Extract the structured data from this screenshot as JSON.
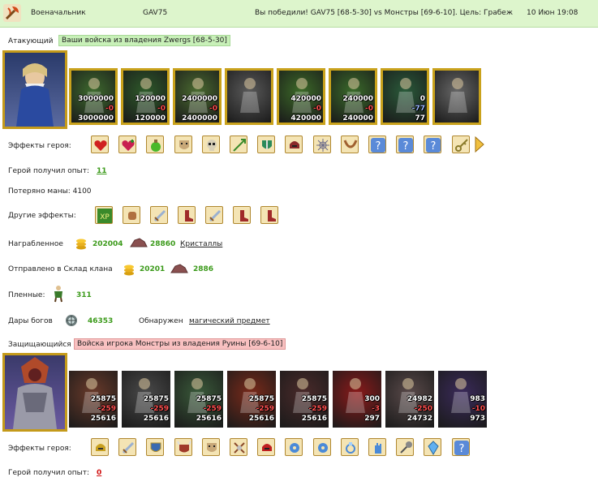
{
  "header": {
    "rank": "Военачальник",
    "player": "GAV75",
    "result": "Вы победили! GAV75 [68-5-30] vs Монстры [69-6-10]. Цель: Грабеж",
    "date": "10 Июн 19:08"
  },
  "attacker": {
    "label": "Атакующий",
    "army": "Ваши войска из владения Zwergs [68-5-30]",
    "units": [
      {
        "name": "unit-1",
        "top": "3000000",
        "mid": "-0",
        "bot": "3000000",
        "color": "#3e6a2e"
      },
      {
        "name": "unit-2",
        "top": "120000",
        "mid": "-0",
        "bot": "120000",
        "color": "#2e5a2a"
      },
      {
        "name": "unit-3",
        "top": "2400000",
        "mid": "-0",
        "bot": "2400000",
        "color": "#4a6a30"
      },
      {
        "name": "unit-4",
        "top": "",
        "mid": "",
        "bot": "",
        "color": "#5a5a5a"
      },
      {
        "name": "unit-5",
        "top": "420000",
        "mid": "-0",
        "bot": "420000",
        "color": "#3c6a28"
      },
      {
        "name": "unit-6",
        "top": "240000",
        "mid": "-0",
        "bot": "240000",
        "color": "#3a6a2a"
      },
      {
        "name": "unit-7",
        "top": "0",
        "mid": "-77",
        "bot": "77",
        "color": "#2a5a3a"
      },
      {
        "name": "unit-8",
        "top": "",
        "mid": "",
        "bot": "",
        "color": "#666"
      }
    ],
    "hero_effects_label": "Эффекты героя:",
    "hero_effects": [
      "heart-icon",
      "heart-plus-icon",
      "potion-icon",
      "mask-icon",
      "skull-mask-icon",
      "arrows-icon",
      "shield-sword-icon",
      "helmet-icon",
      "web-icon",
      "horns-icon",
      "question-icon",
      "question-icon",
      "question-icon",
      "key-icon"
    ],
    "exp_label": "Герой получил опыт:",
    "exp_value": "11",
    "mana_label": "Потеряно маны: 4100",
    "other_label": "Другие эффекты:",
    "other_effects": [
      "xp-icon",
      "fist-icon",
      "sword-icon",
      "boot-icon",
      "sword-icon",
      "boot-icon",
      "boot-icon"
    ],
    "loot_label": "Награбленное",
    "loot_gold": "202004",
    "loot_crystal": "28860",
    "loot_crystal_link": "Кристаллы",
    "clan_label": "Отправлено в Склад клана",
    "clan_gold": "20201",
    "clan_crystal": "2886",
    "prisoners_label": "Пленные:",
    "prisoners_value": "311",
    "gifts_label": "Дары богов",
    "gifts_value": "46353",
    "found_label": "Обнаружен",
    "found_link": "магический предмет"
  },
  "defender": {
    "label": "Защищающийся",
    "army": "Войска игрока Монстры из владения Руины [69-6-10]",
    "units": [
      {
        "name": "unit-1",
        "top": "25875",
        "mid": "-259",
        "bot": "25616",
        "color": "#6a3a2a"
      },
      {
        "name": "unit-2",
        "top": "25875",
        "mid": "-259",
        "bot": "25616",
        "color": "#4a4a4a"
      },
      {
        "name": "unit-3",
        "top": "25875",
        "mid": "-259",
        "bot": "25616",
        "color": "#3a5a3a"
      },
      {
        "name": "unit-4",
        "top": "25875",
        "mid": "-259",
        "bot": "25616",
        "color": "#7a2a1a"
      },
      {
        "name": "unit-5",
        "top": "25875",
        "mid": "-259",
        "bot": "25616",
        "color": "#4a2a2a"
      },
      {
        "name": "unit-6",
        "top": "300",
        "mid": "-3",
        "bot": "297",
        "color": "#8a1a1a"
      },
      {
        "name": "unit-7",
        "top": "24982",
        "mid": "-250",
        "bot": "24732",
        "color": "#5a4a4a"
      },
      {
        "name": "unit-8",
        "top": "983",
        "mid": "-10",
        "bot": "973",
        "color": "#3a2a5a"
      }
    ],
    "hero_effects_label": "Эффекты героя:",
    "hero_effects": [
      "helmet-gold-icon",
      "sword-icon",
      "shield-icon",
      "horned-mask-icon",
      "mask-icon",
      "axes-icon",
      "helm-red-icon",
      "gear-icon",
      "gear-icon",
      "ring-icon",
      "hand-icon",
      "mace-icon",
      "crystal-icon",
      "question-icon"
    ],
    "exp_label": "Герой получил опыт:",
    "exp_value": "0"
  },
  "colors": {
    "topbar_bg": "#ddf5cc",
    "green_value": "#3b9a1a",
    "red_value": "#d01010"
  }
}
